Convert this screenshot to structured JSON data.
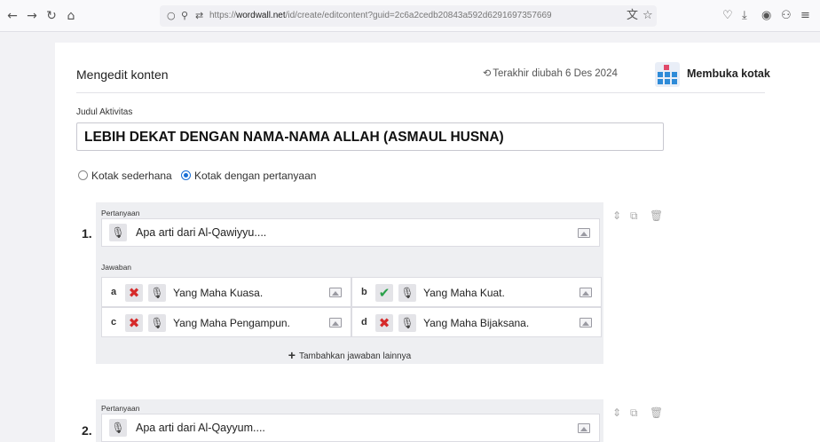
{
  "browser": {
    "url_prefix": "https://",
    "url_host": "wordwall.net",
    "url_path": "/id/create/editcontent?guid=2c6a2cedb20843a592d6291697357669",
    "icons": [
      "back-icon",
      "forward-icon",
      "reload-icon",
      "home-icon",
      "shield-icon",
      "lock-icon",
      "permissions-icon",
      "translate-icon",
      "bookmark-star-icon",
      "pocket-icon",
      "download-icon",
      "extensions-icon",
      "account-icon",
      "menu-icon"
    ]
  },
  "header": {
    "title": "Mengedit konten",
    "last_edit": "Terakhir diubah 6 Des 2024",
    "template_label": "Membuka kotak"
  },
  "activity": {
    "title_label": "Judul Aktivitas",
    "title_value": "LEBIH DEKAT DENGAN NAMA-NAMA ALLAH (ASMAUL HUSNA)"
  },
  "mode": {
    "options": [
      "Kotak sederhana",
      "Kotak dengan pertanyaan"
    ],
    "selected": "Kotak dengan pertanyaan"
  },
  "questions": [
    {
      "number": "1.",
      "label": "Pertanyaan",
      "text": "Apa arti dari  Al-Qawiyyu....",
      "answers_label": "Jawaban",
      "answers": [
        {
          "letter": "a",
          "correct": false,
          "text": "Yang Maha Kuasa."
        },
        {
          "letter": "b",
          "correct": true,
          "text": "Yang Maha Kuat."
        },
        {
          "letter": "c",
          "correct": false,
          "text": "Yang Maha Pengampun."
        },
        {
          "letter": "d",
          "correct": false,
          "text": "Yang Maha Bijaksana."
        }
      ],
      "add_answer_label": "Tambahkan jawaban lainnya"
    },
    {
      "number": "2.",
      "label": "Pertanyaan",
      "text": "Apa arti dari Al-Qayyum...."
    }
  ],
  "colors": {
    "accent": "#1a6fd6",
    "wrong": "#d62a2a",
    "correct": "#2aa04a",
    "template_icon": "#2e8bd8"
  }
}
